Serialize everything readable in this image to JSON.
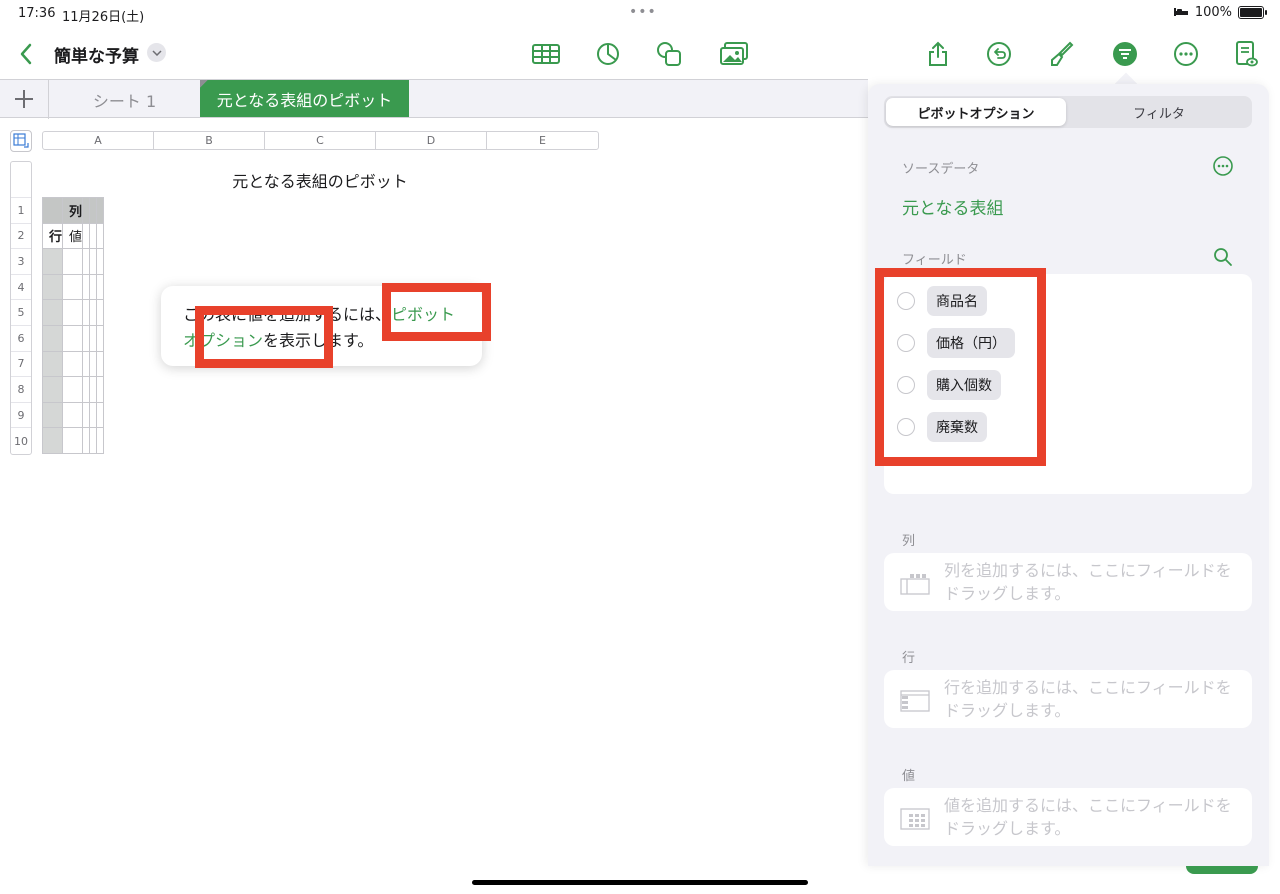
{
  "status": {
    "time": "17:36",
    "date": "11月26日(土)",
    "battery": "100%"
  },
  "toolbar": {
    "doc_title": "簡単な予算",
    "icons": [
      "back-icon",
      "table-icon",
      "chart-icon",
      "shape-icon",
      "media-icon",
      "share-icon",
      "undo-icon",
      "format-brush-icon",
      "organize-icon",
      "more-icon",
      "document-view-icon"
    ]
  },
  "tabs": {
    "sheet1": "シート 1",
    "pivot": "元となる表組のピボット"
  },
  "sheet": {
    "columns": [
      "A",
      "B",
      "C",
      "D",
      "E"
    ],
    "rows": [
      "1",
      "2",
      "3",
      "4",
      "5",
      "6",
      "7",
      "8",
      "9",
      "10"
    ],
    "table_title": "元となる表組のピボット",
    "cells": {
      "b1": "列",
      "a2": "行",
      "b2": "値"
    }
  },
  "popover": {
    "text_before": "この表に値を追加するには、",
    "link": "ピボットオプション",
    "text_after": "を表示します。"
  },
  "panel": {
    "tabs": {
      "active": "ピボットオプション",
      "inactive": "フィルタ"
    },
    "source_label": "ソースデータ",
    "source_value": "元となる表組",
    "fields_label": "フィールド",
    "fields": [
      "商品名",
      "価格（円）",
      "購入個数",
      "廃棄数"
    ],
    "columns_label": "列",
    "columns_hint": "列を追加するには、ここにフィールドをドラッグします。",
    "rows_label": "行",
    "rows_hint": "行を追加するには、ここにフィールドをドラッグします。",
    "values_label": "値",
    "values_hint": "値を追加するには、ここにフィールドをドラッグします。"
  },
  "colors": {
    "accent": "#3a9a4f",
    "highlight": "#e8412b"
  }
}
